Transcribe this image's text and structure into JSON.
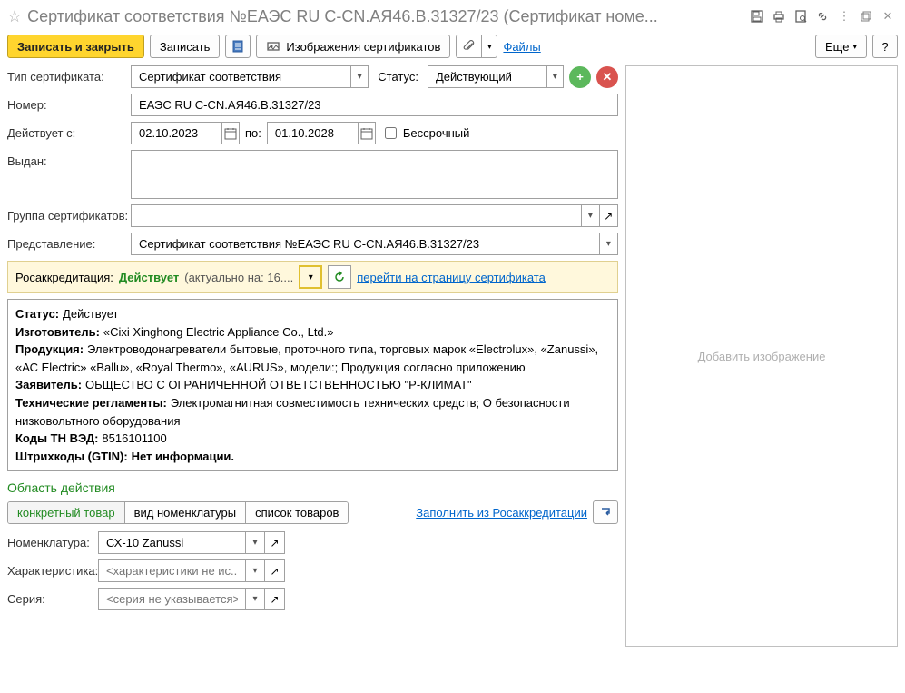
{
  "title": "Сертификат соответствия №ЕАЭС RU С-CN.АЯ46.В.31327/23 (Сертификат номе...",
  "toolbar": {
    "save_close": "Записать и закрыть",
    "save": "Записать",
    "cert_images": "Изображения сертификатов",
    "files": "Файлы",
    "more": "Еще",
    "help": "?"
  },
  "labels": {
    "cert_type": "Тип сертификата:",
    "status": "Статус:",
    "number": "Номер:",
    "valid_from": "Действует с:",
    "to": "по:",
    "perpetual": "Бессрочный",
    "issued": "Выдан:",
    "cert_group": "Группа сертификатов:",
    "representation": "Представление:",
    "rosaccred": "Росаккредитация:",
    "nomenclature": "Номенклатура:",
    "characteristic": "Характеристика:",
    "series": "Серия:"
  },
  "values": {
    "cert_type": "Сертификат соответствия",
    "status": "Действующий",
    "number": "ЕАЭС RU С-CN.АЯ46.В.31327/23",
    "date_from": "02.10.2023",
    "date_to": "01.10.2028",
    "representation": "Сертификат соответствия №ЕАЭС RU С-CN.АЯ46.В.31327/23",
    "nomenclature": "СХ-10 Zanussi"
  },
  "placeholders": {
    "characteristic": "<характеристики не ис...",
    "series": "<серия не указывается>"
  },
  "accred": {
    "status": "Действует",
    "date_prefix": "(актуально на: 16....",
    "link": "перейти на страницу сертификата"
  },
  "details": {
    "status_label": "Статус:",
    "status_value": "Действует",
    "manufacturer_label": "Изготовитель:",
    "manufacturer_value": "«Cixi Xinghong Electric Appliance Co., Ltd.»",
    "product_label": "Продукция:",
    "product_value": "Электроводонагреватели бытовые, проточного типа, торговых марок «Electrolux», «Zanussi», «АС Electric» «Ballu», «Royal Thermo», «AURUS», модели:; Продукция согласно приложению",
    "applicant_label": "Заявитель:",
    "applicant_value": "ОБЩЕСТВО С ОГРАНИЧЕННОЙ ОТВЕТСТВЕННОСТЬЮ \"Р-КЛИМАТ\"",
    "regulations_label": "Технические регламенты:",
    "regulations_value": "Электромагнитная совместимость технических средств; О безопасности низковольтного оборудования",
    "tnved_label": "Коды ТН ВЭД:",
    "tnved_value": "8516101100",
    "barcode_label": "Штрихкоды (GTIN):",
    "barcode_value": "Нет информации."
  },
  "scope": {
    "title": "Область действия",
    "tab1": "конкретный товар",
    "tab2": "вид номенклатуры",
    "tab3": "список товаров",
    "fill_link": "Заполнить из Росаккредитации"
  },
  "image_panel": {
    "placeholder": "Добавить изображение"
  }
}
